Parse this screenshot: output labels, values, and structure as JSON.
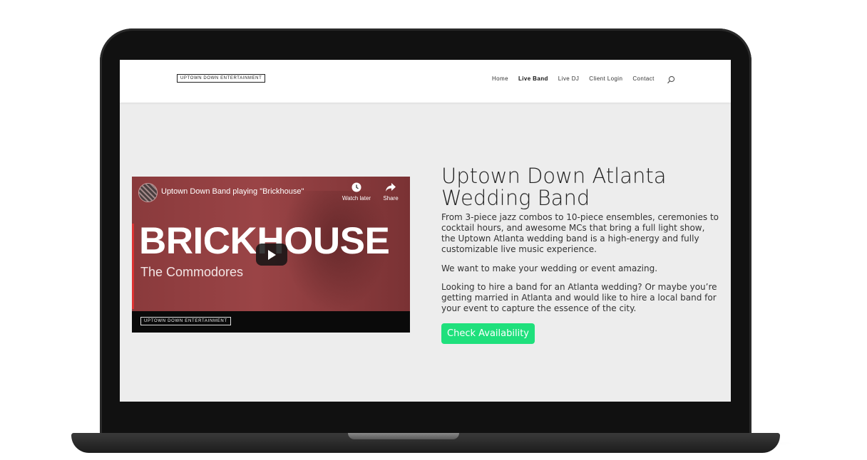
{
  "site": {
    "logo_text": "UPTOWN DOWN ENTERTAINMENT"
  },
  "nav": {
    "items": [
      {
        "label": "Home",
        "active": false
      },
      {
        "label": "Live Band",
        "active": true
      },
      {
        "label": "Live DJ",
        "active": false
      },
      {
        "label": "Client Login",
        "active": false
      },
      {
        "label": "Contact",
        "active": false
      }
    ],
    "search_icon": "search-icon"
  },
  "video": {
    "title": "Uptown Down Band playing \"Brickhouse\"",
    "watch_later_label": "Watch later",
    "share_label": "Share",
    "overlay_title": "BRICKHOUSE",
    "overlay_artist": "The Commodores",
    "bottom_logo": "UPTOWN DOWN ENTERTAINMENT",
    "icons": [
      "clock-icon",
      "share-arrow-icon",
      "play-icon"
    ]
  },
  "content": {
    "headline": "Uptown Down Atlanta Wedding Band",
    "paragraph1": "From 3-piece jazz combos to 10-piece ensembles, ceremonies to cocktail hours, and awesome MCs that bring a full light show, the Uptown Atlanta wedding band is a high-energy and fully customizable live music experience.",
    "paragraph2": "We want to make your wedding or event amazing.",
    "paragraph3": "Looking to hire a band for an Atlanta wedding? Or maybe you’re getting married in Atlanta and would like to hire a local band for your event to capture the essence of the city.",
    "cta_label": "Check Availability"
  },
  "colors": {
    "cta": "#1fe07c",
    "page_bg": "#ededed",
    "video_red": "#9a4446"
  }
}
